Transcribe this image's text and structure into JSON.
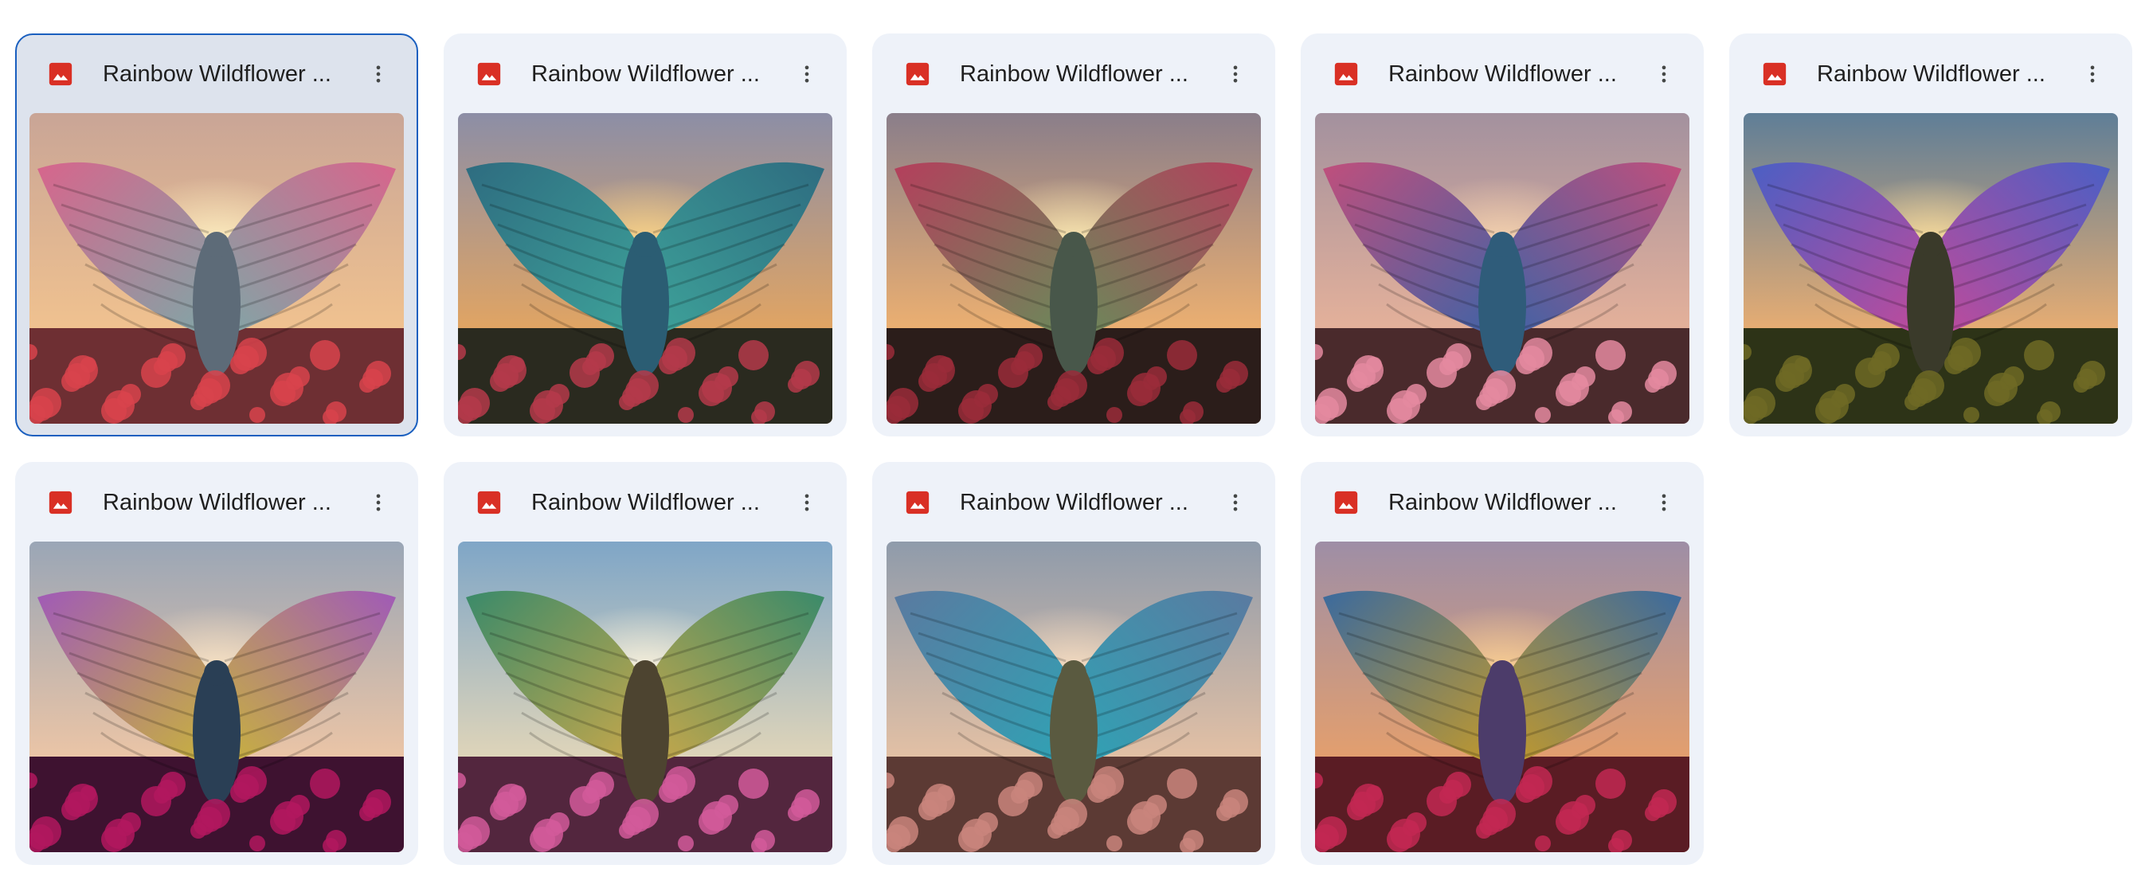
{
  "files": [
    {
      "title": "Rainbow Wildflower ...",
      "selected": true,
      "icon": "image-file-icon",
      "colors": {
        "sky_top": "#c9a596",
        "sky_low": "#f3c48f",
        "sun": "#fff2c4",
        "wing_a": "#d7658c",
        "wing_b": "#7fa7a7",
        "body": "#5d6b78",
        "ground": "#6e2f33",
        "flowers": "#d8434c"
      }
    },
    {
      "title": "Rainbow Wildflower ...",
      "selected": false,
      "icon": "image-file-icon",
      "colors": {
        "sky_top": "#8c8ea6",
        "sky_low": "#e7a65e",
        "sun": "#ffd98a",
        "wing_a": "#2e6c80",
        "wing_b": "#3ea39a",
        "body": "#2b5d73",
        "ground": "#2a2a1f",
        "flowers": "#b43a4a"
      }
    },
    {
      "title": "Rainbow Wildflower ...",
      "selected": false,
      "icon": "image-file-icon",
      "colors": {
        "sky_top": "#8a7e8a",
        "sky_low": "#f3b36f",
        "sun": "#fff0b8",
        "wing_a": "#b43f5c",
        "wing_b": "#6a8a5a",
        "body": "#48574a",
        "ground": "#2b1d1a",
        "flowers": "#9a2b3a"
      }
    },
    {
      "title": "Rainbow Wildflower ...",
      "selected": false,
      "icon": "image-file-icon",
      "colors": {
        "sky_top": "#a3919e",
        "sky_low": "#e9b39a",
        "sun": "#f9d7b0",
        "wing_a": "#c04f7c",
        "wing_b": "#3f63a6",
        "body": "#2f5c7a",
        "ground": "#4a2a2c",
        "flowers": "#e48aa0"
      }
    },
    {
      "title": "Rainbow Wildflower ...",
      "selected": false,
      "icon": "image-file-icon",
      "colors": {
        "sky_top": "#5f7e97",
        "sky_low": "#f0b070",
        "sun": "#ffe3a0",
        "wing_a": "#4b5fc4",
        "wing_b": "#c24a9a",
        "body": "#3a3a2a",
        "ground": "#2d3317",
        "flowers": "#6f6a24"
      }
    },
    {
      "title": "Rainbow Wildflower ...",
      "selected": false,
      "icon": "image-file-icon",
      "colors": {
        "sky_top": "#9aa6b6",
        "sky_low": "#f1c7a5",
        "sun": "#fde7c7",
        "wing_a": "#a05ab7",
        "wing_b": "#c9b43a",
        "body": "#2a3f55",
        "ground": "#3e1230",
        "flowers": "#b2175e"
      }
    },
    {
      "title": "Rainbow Wildflower ...",
      "selected": false,
      "icon": "image-file-icon",
      "colors": {
        "sky_top": "#7fa6c7",
        "sky_low": "#e6d8b8",
        "sun": "#fff6df",
        "wing_a": "#3a8a6a",
        "wing_b": "#c9a84a",
        "body": "#4d4430",
        "ground": "#53263e",
        "flowers": "#d25a9a"
      }
    },
    {
      "title": "Rainbow Wildflower ...",
      "selected": false,
      "icon": "image-file-icon",
      "colors": {
        "sky_top": "#8f9bab",
        "sky_low": "#e9c3a4",
        "sun": "#fbe1c4",
        "wing_a": "#5a7aa0",
        "wing_b": "#2fa3b5",
        "body": "#5a5a40",
        "ground": "#5c3a34",
        "flowers": "#c9857c"
      }
    },
    {
      "title": "Rainbow Wildflower ...",
      "selected": false,
      "icon": "image-file-icon",
      "colors": {
        "sky_top": "#9e8ea6",
        "sky_low": "#e8a06a",
        "sun": "#ffd596",
        "wing_a": "#3b6a9e",
        "wing_b": "#c49a2a",
        "body": "#4c3c6a",
        "ground": "#5a1c24",
        "flowers": "#c22852"
      }
    }
  ]
}
